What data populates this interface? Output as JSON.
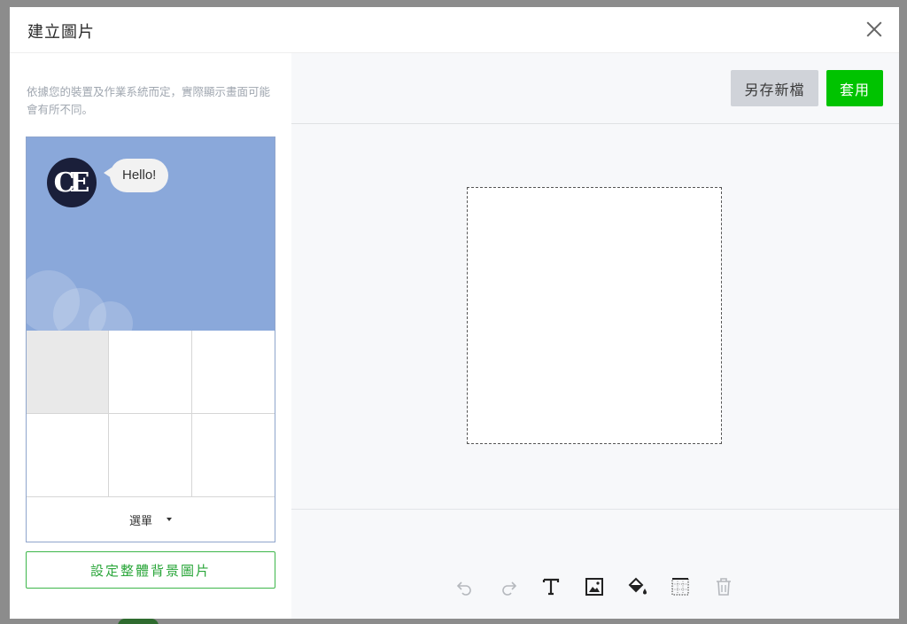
{
  "modal": {
    "title": "建立圖片"
  },
  "left": {
    "hint": "依據您的裝置及作業系統而定，實際顯示畫面可能會有所不同。",
    "chat_bubble": "Hello!",
    "avatar_initials": "CE",
    "menu_label": "選單",
    "bg_button": "設定整體背景圖片"
  },
  "right": {
    "save_label": "另存新檔",
    "apply_label": "套用"
  },
  "toolbar": {
    "icons": [
      "undo-icon",
      "redo-icon",
      "text-icon",
      "image-icon",
      "fill-bucket-icon",
      "grid-icon",
      "trash-icon"
    ]
  },
  "colors": {
    "accent_green": "#00c300",
    "chat_bg": "#8aa8da",
    "outline_green": "#3db64a"
  }
}
